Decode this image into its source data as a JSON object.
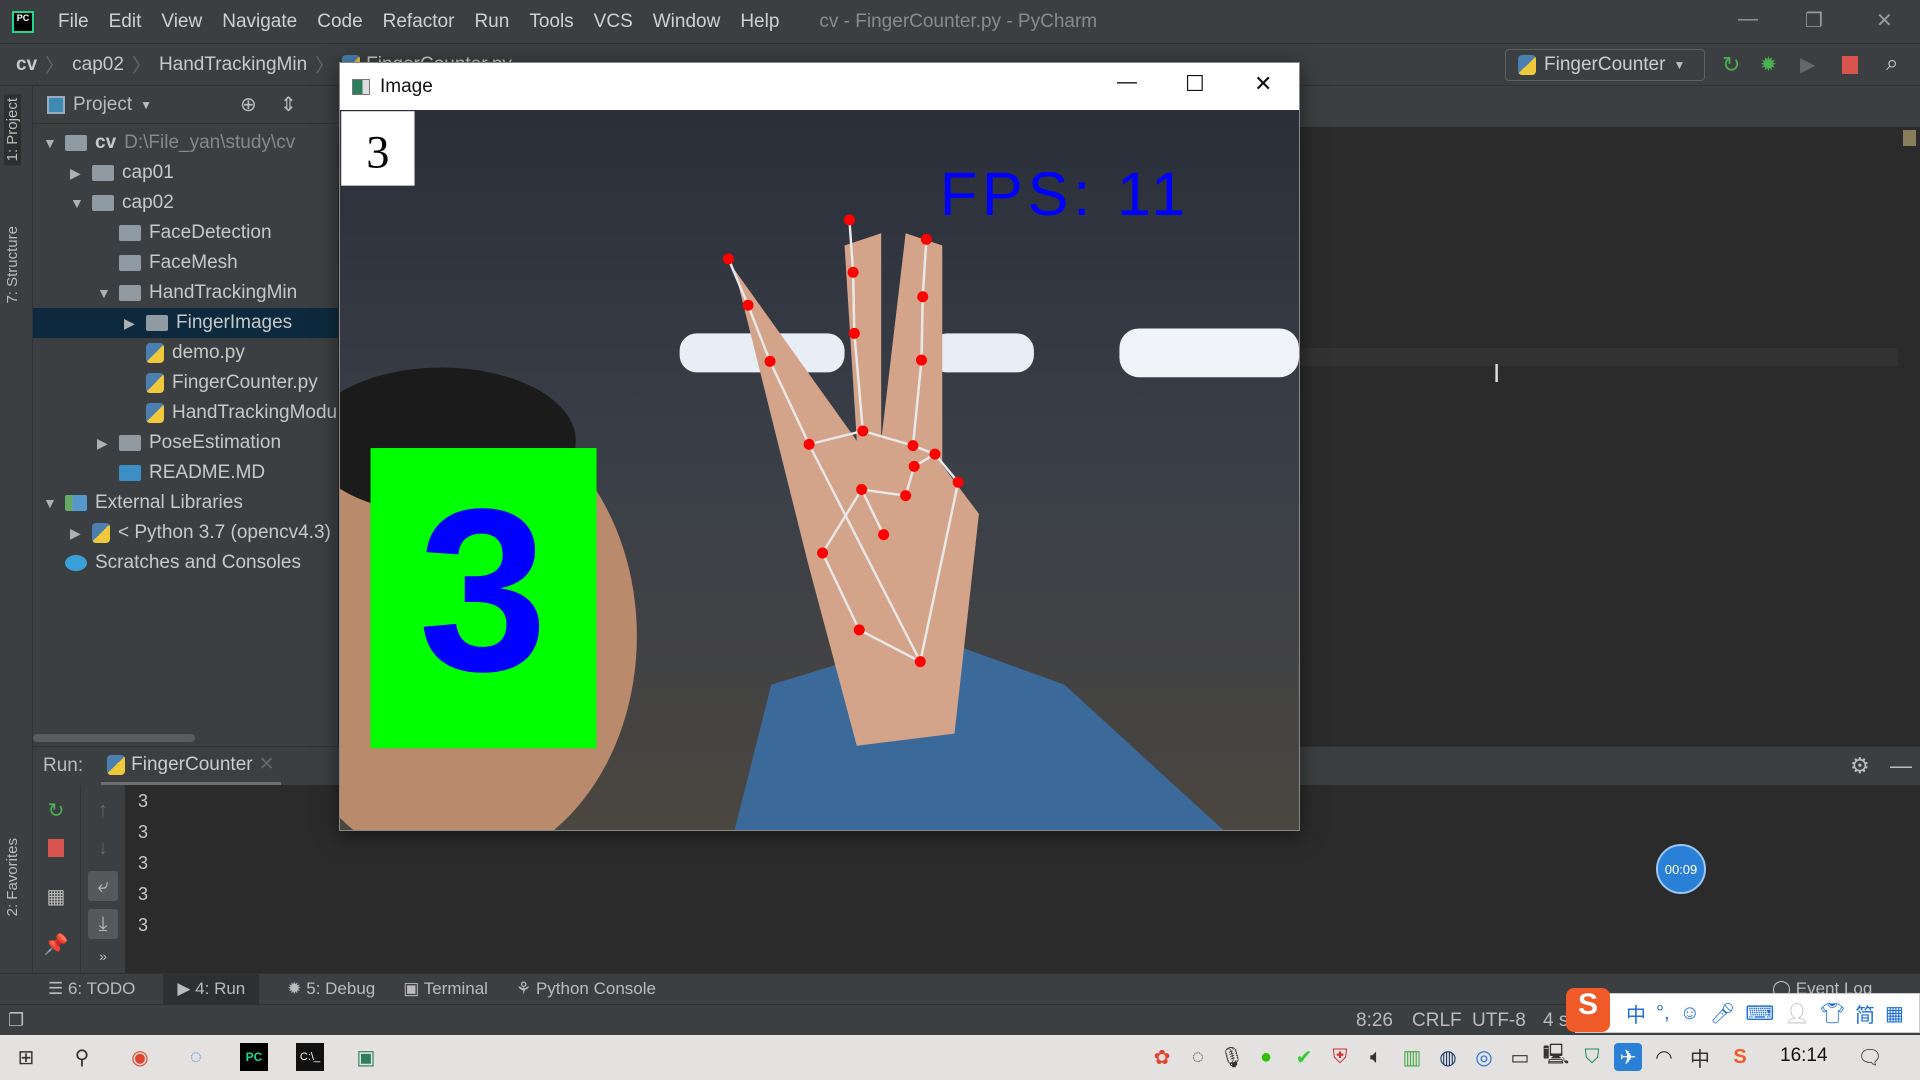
{
  "window": {
    "title": "cv - FingerCounter.py - PyCharm"
  },
  "menu": [
    "File",
    "Edit",
    "View",
    "Navigate",
    "Code",
    "Refactor",
    "Run",
    "Tools",
    "VCS",
    "Window",
    "Help"
  ],
  "breadcrumb": [
    "cv",
    "cap02",
    "HandTrackingMin",
    "FingerCounter.py"
  ],
  "run_config": {
    "label": "FingerCounter"
  },
  "side_tabs": {
    "project": "1: Project",
    "structure": "7: Structure",
    "favorites": "2: Favorites"
  },
  "project": {
    "header": "Project",
    "tree": [
      {
        "label": "cv",
        "path": "D:\\File_yan\\study\\cv",
        "depth": 0,
        "expander": "open",
        "icon": "folder"
      },
      {
        "label": "cap01",
        "depth": 1,
        "expander": "closed",
        "icon": "folder"
      },
      {
        "label": "cap02",
        "depth": 1,
        "expander": "open",
        "icon": "folder"
      },
      {
        "label": "FaceDetection",
        "depth": 2,
        "expander": "none",
        "icon": "folder"
      },
      {
        "label": "FaceMesh",
        "depth": 2,
        "expander": "none",
        "icon": "folder"
      },
      {
        "label": "HandTrackingMin",
        "depth": 2,
        "expander": "open",
        "icon": "folder"
      },
      {
        "label": "FingerImages",
        "depth": 3,
        "expander": "closed",
        "icon": "folder",
        "selected": true
      },
      {
        "label": "demo.py",
        "depth": 3,
        "expander": "none",
        "icon": "python-file"
      },
      {
        "label": "FingerCounter.py",
        "depth": 3,
        "expander": "none",
        "icon": "python-file"
      },
      {
        "label": "HandTrackingModule.py",
        "depth": 3,
        "expander": "none",
        "icon": "python-file"
      },
      {
        "label": "PoseEstimation",
        "depth": 2,
        "expander": "closed",
        "icon": "folder"
      },
      {
        "label": "README.MD",
        "depth": 2,
        "expander": "none",
        "icon": "markdown-file"
      },
      {
        "label": "External Libraries",
        "depth": 0,
        "expander": "open",
        "icon": "library"
      },
      {
        "label": "< Python 3.7 (opencv4.3)",
        "depth": 1,
        "expander": "closed",
        "icon": "python"
      },
      {
        "label": "Scratches and Consoles",
        "depth": 0,
        "expander": "none",
        "icon": "scratches"
      }
    ]
  },
  "run": {
    "label": "Run:",
    "tab": "FingerCounter",
    "output": [
      "3",
      "3",
      "3",
      "3",
      "3"
    ]
  },
  "bottom_tabs": [
    "6: TODO",
    "4: Run",
    "5: Debug",
    "Terminal",
    "Python Console"
  ],
  "event_log": "Event Log",
  "status": {
    "position": "8:26",
    "line_sep": "CRLF",
    "encoding": "UTF-8",
    "indent": "4 spaces"
  },
  "image_window": {
    "title": "Image",
    "count_label": "3",
    "fps_text": "FPS: 11",
    "finger_count": "3"
  },
  "ime": {
    "mode": "中",
    "punct": "°,",
    "simplified": "简"
  },
  "recorder": {
    "time": "00:09"
  },
  "taskbar": {
    "clock": "16:14"
  },
  "colors": {
    "green_box": "#00ff00",
    "digit_blue": "#0000ff",
    "landmark": "#ff0000",
    "selection": "#0d293e"
  }
}
